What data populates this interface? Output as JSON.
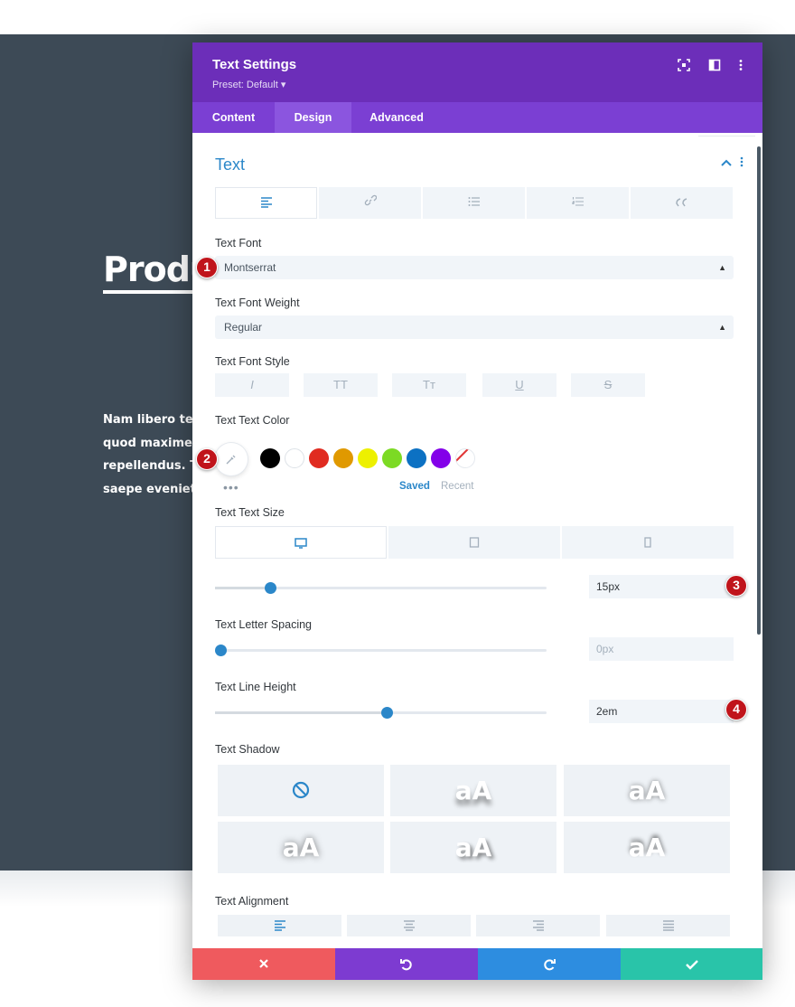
{
  "page": {
    "hero_title": "Produc",
    "hero_lines": [
      "Nam libero tem",
      "quod maxime r",
      "repellendus. Te",
      "saepe eveniet u"
    ]
  },
  "modal": {
    "title": "Text Settings",
    "preset": "Preset: Default ▾",
    "header_icons": [
      "fullscreen-icon",
      "split-view-icon",
      "more-options-icon"
    ],
    "tabs": [
      {
        "label": "Content",
        "active": false
      },
      {
        "label": "Design",
        "active": true
      },
      {
        "label": "Advanced",
        "active": false
      }
    ]
  },
  "section": {
    "title": "Text",
    "subtabs": [
      "align-left-icon",
      "link-icon",
      "list-icon",
      "ordered-list-icon",
      "quote-icon"
    ]
  },
  "fields": {
    "font_label": "Text Font",
    "font_value": "Montserrat",
    "weight_label": "Text Font Weight",
    "weight_value": "Regular",
    "style_label": "Text Font Style",
    "style_buttons": [
      "I",
      "TT",
      "Tт",
      "U",
      "S"
    ],
    "color_label": "Text Text Color",
    "swatches": [
      "#000000",
      "#ffffff",
      "#e02b20",
      "#e09900",
      "#edf000",
      "#7cda24",
      "#0c71c3",
      "#8300e9",
      "none"
    ],
    "saved_label": "Saved",
    "recent_label": "Recent",
    "size_label": "Text Text Size",
    "size_value": "15px",
    "size_slider_fraction": 0.15,
    "letter_label": "Text Letter Spacing",
    "letter_value": "0px",
    "letter_slider_fraction": 0.0,
    "lineheight_label": "Text Line Height",
    "lineheight_value": "2em",
    "lineheight_slider_fraction": 0.5,
    "shadow_label": "Text Shadow",
    "shadow_sample": "aA",
    "align_label": "Text Alignment"
  },
  "markers": [
    "1",
    "2",
    "3",
    "4"
  ],
  "colors": {
    "header": "#6c2eb9",
    "tabs": "#7b3fd3",
    "accent": "#2b87c9",
    "cancel": "#ef5a5e",
    "undo": "#7d3bd1",
    "redo": "#2d8de0",
    "save": "#29c4a9",
    "marker": "#c0141b"
  }
}
